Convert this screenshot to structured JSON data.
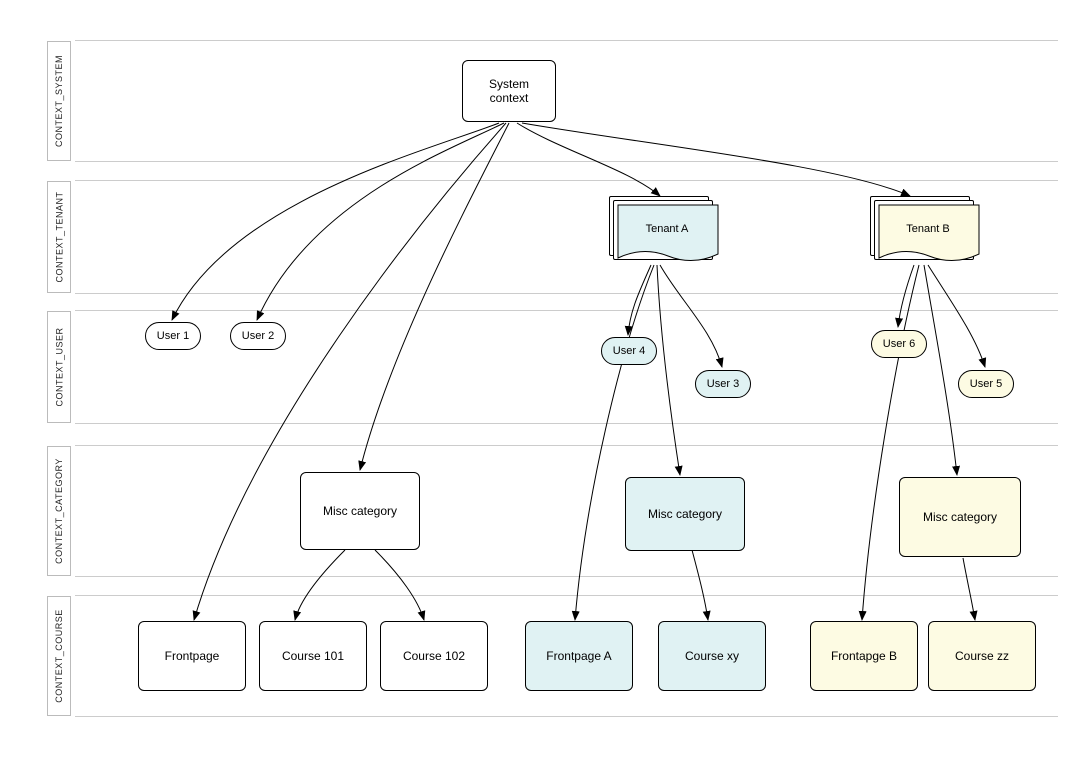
{
  "lanes": {
    "system": "CONTEXT_SYSTEM",
    "tenant": "CONTEXT_TENANT",
    "user": "CONTEXT_USER",
    "category": "CONTEXT_CATEGORY",
    "course": "CONTEXT_COURSE"
  },
  "nodes": {
    "system_context": "System\ncontext",
    "tenant_a": "Tenant A",
    "tenant_b": "Tenant B",
    "user1": "User 1",
    "user2": "User 2",
    "user3": "User 3",
    "user4": "User 4",
    "user5": "User 5",
    "user6": "User 6",
    "misc_sys": "Misc category",
    "misc_a": "Misc category",
    "misc_b": "Misc category",
    "frontpage": "Frontpage",
    "course101": "Course 101",
    "course102": "Course 102",
    "frontpage_a": "Frontpage A",
    "course_xy": "Course xy",
    "frontpage_b": "Frontapge B",
    "course_zz": "Course zz"
  },
  "colors": {
    "blue": "#e0f2f3",
    "yellow": "#fdfbe3"
  },
  "edges": [
    {
      "from": "system_context",
      "to": "user1"
    },
    {
      "from": "system_context",
      "to": "user2"
    },
    {
      "from": "system_context",
      "to": "misc_sys"
    },
    {
      "from": "system_context",
      "to": "frontpage"
    },
    {
      "from": "system_context",
      "to": "tenant_a"
    },
    {
      "from": "system_context",
      "to": "tenant_b"
    },
    {
      "from": "tenant_a",
      "to": "user4"
    },
    {
      "from": "tenant_a",
      "to": "user3"
    },
    {
      "from": "tenant_a",
      "to": "misc_a"
    },
    {
      "from": "tenant_a",
      "to": "frontpage_a"
    },
    {
      "from": "tenant_b",
      "to": "user6"
    },
    {
      "from": "tenant_b",
      "to": "user5"
    },
    {
      "from": "tenant_b",
      "to": "misc_b"
    },
    {
      "from": "tenant_b",
      "to": "frontpage_b"
    },
    {
      "from": "misc_sys",
      "to": "course101"
    },
    {
      "from": "misc_sys",
      "to": "course102"
    },
    {
      "from": "misc_a",
      "to": "course_xy"
    },
    {
      "from": "misc_b",
      "to": "course_zz"
    }
  ]
}
